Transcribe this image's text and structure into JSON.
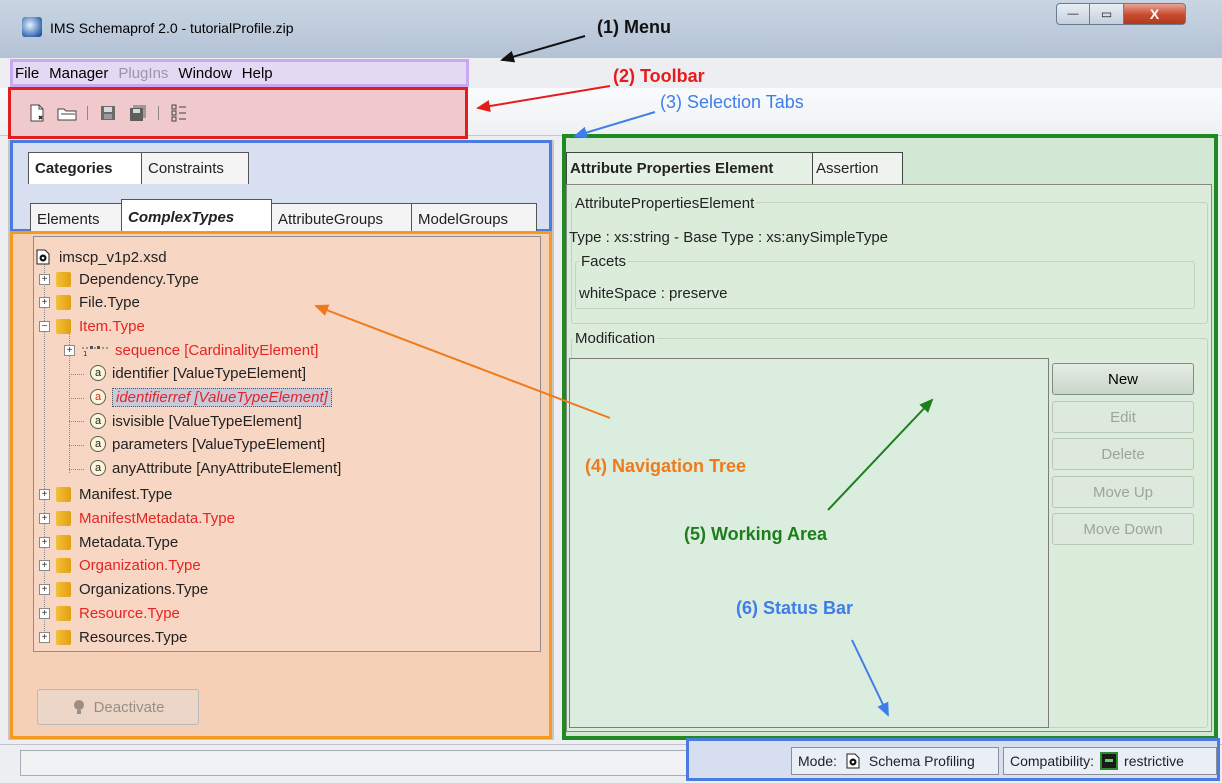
{
  "window": {
    "title": "IMS Schemaprof 2.0 - tutorialProfile.zip",
    "controls": {
      "minimize": "—",
      "maximize": "▭",
      "close": "X"
    }
  },
  "menu": {
    "items": [
      {
        "label": "File",
        "enabled": true
      },
      {
        "label": "Manager",
        "enabled": true
      },
      {
        "label": "PlugIns",
        "enabled": false
      },
      {
        "label": "Window",
        "enabled": true
      },
      {
        "label": "Help",
        "enabled": true
      }
    ]
  },
  "toolbar": {
    "icons": [
      "new-document-icon",
      "open-folder-icon",
      "save-icon",
      "save-all-icon",
      "list-settings-icon"
    ]
  },
  "left": {
    "top_tabs": [
      "Categories",
      "Constraints"
    ],
    "sub_tabs": [
      "Elements",
      "ComplexTypes",
      "AttributeGroups",
      "ModelGroups"
    ],
    "selected_top_tab": "Categories",
    "selected_sub_tab": "ComplexTypes",
    "tree": {
      "root": "imscp_v1p2.xsd",
      "nodes": [
        {
          "label": "Dependency.Type",
          "red": false
        },
        {
          "label": "File.Type",
          "red": false
        },
        {
          "label": "Item.Type",
          "red": true
        },
        {
          "label": "sequence [CardinalityElement]",
          "red": true
        },
        {
          "label": "identifier [ValueTypeElement]",
          "red": false
        },
        {
          "label": "identifierref [ValueTypeElement]",
          "red": true
        },
        {
          "label": "isvisible [ValueTypeElement]",
          "red": false
        },
        {
          "label": "parameters [ValueTypeElement]",
          "red": false
        },
        {
          "label": "anyAttribute [AnyAttributeElement]",
          "red": false
        },
        {
          "label": "Manifest.Type",
          "red": false
        },
        {
          "label": "ManifestMetadata.Type",
          "red": true
        },
        {
          "label": "Metadata.Type",
          "red": false
        },
        {
          "label": "Organization.Type",
          "red": true
        },
        {
          "label": "Organizations.Type",
          "red": false
        },
        {
          "label": "Resource.Type",
          "red": true
        },
        {
          "label": "Resources.Type",
          "red": false
        }
      ]
    },
    "deactivate_label": "Deactivate"
  },
  "right": {
    "tabs": [
      "Attribute Properties Element",
      "Assertion"
    ],
    "selected_tab": "Attribute Properties Element",
    "properties_legend": "AttributePropertiesElement",
    "type_line": "Type  :  xs:string  -  Base Type  :  xs:anySimpleType",
    "facets_legend": "Facets",
    "facet_line": "whiteSpace  :  preserve",
    "modification_legend": "Modification",
    "buttons": [
      {
        "label": "New",
        "enabled": true
      },
      {
        "label": "Edit",
        "enabled": false
      },
      {
        "label": "Delete",
        "enabled": false
      },
      {
        "label": "Move Up",
        "enabled": false
      },
      {
        "label": "Move Down",
        "enabled": false
      }
    ]
  },
  "status": {
    "mode_label": "Mode:",
    "mode_value": "Schema Profiling",
    "compat_label": "Compatibility:",
    "compat_value": "restrictive"
  },
  "annotations": {
    "menu": "(1) Menu",
    "toolbar": "(2) Toolbar",
    "selection_tabs": "(3) Selection Tabs",
    "navigation_tree": "(4) Navigation Tree",
    "working_area": "(5) Working Area",
    "status_bar": "(6) Status Bar"
  },
  "colors": {
    "menu_box": "#c8a8ee",
    "toolbar_box": "#e31c1c",
    "tabs_box": "#4b7be0",
    "nav_box": "#f39a1f",
    "work_box": "#1f8a1f",
    "status_box": "#4b7be0",
    "highlight_red": "#e62424"
  }
}
